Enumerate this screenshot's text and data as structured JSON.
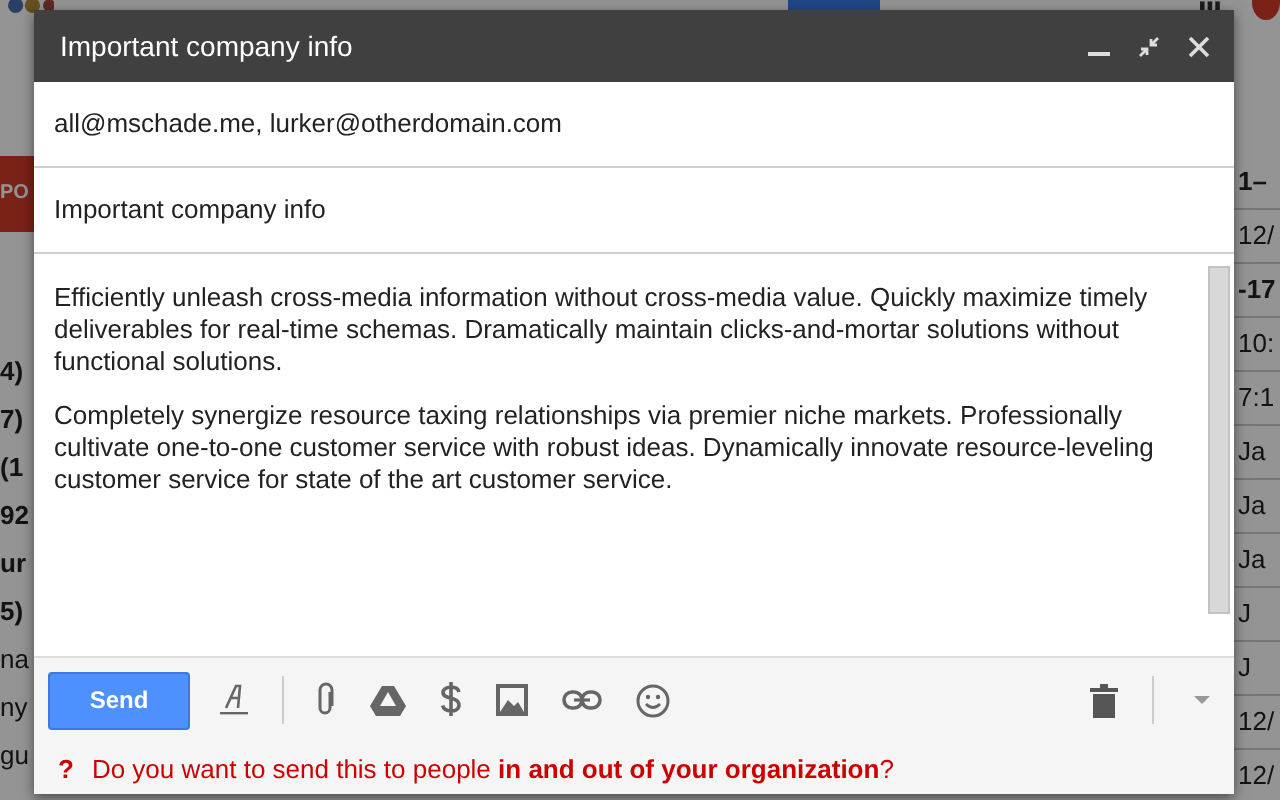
{
  "background": {
    "left_items": [
      {
        "text": "PO",
        "kind": "button"
      },
      {
        "text": "4)",
        "kind": "bold"
      },
      {
        "text": "7)",
        "kind": "bold"
      },
      {
        "text": "(1",
        "kind": "bold"
      },
      {
        "text": "92",
        "kind": "bold"
      },
      {
        "text": "ur",
        "kind": "bold"
      },
      {
        "text": "5)",
        "kind": "bold"
      },
      {
        "text": "na",
        "kind": "plain"
      },
      {
        "text": "ny",
        "kind": "plain"
      },
      {
        "text": "gu",
        "kind": "plain"
      }
    ],
    "right_items": [
      {
        "text": "1–",
        "kind": "bold"
      },
      {
        "text": "12/",
        "kind": "plain"
      },
      {
        "text": "-17",
        "kind": "bold"
      },
      {
        "text": "10:",
        "kind": "plain"
      },
      {
        "text": "7:1",
        "kind": "plain"
      },
      {
        "text": "Ja",
        "kind": "plain"
      },
      {
        "text": "Ja",
        "kind": "plain"
      },
      {
        "text": "Ja",
        "kind": "plain"
      },
      {
        "text": "J",
        "kind": "plain"
      },
      {
        "text": "J",
        "kind": "plain"
      },
      {
        "text": "12/",
        "kind": "plain"
      },
      {
        "text": "12/",
        "kind": "plain"
      }
    ]
  },
  "compose": {
    "title": "Important company info",
    "to": "all@mschade.me, lurker@otherdomain.com",
    "subject": "Important company info",
    "body": [
      "Efficiently unleash cross-media information without cross-media value. Quickly maximize timely deliverables for real-time schemas. Dramatically maintain clicks-and-mortar solutions without functional solutions.",
      "Completely synergize resource taxing relationships via premier niche markets. Professionally cultivate one-to-one customer service with robust ideas. Dynamically innovate resource-leveling customer service for state of the art customer service."
    ],
    "send_label": "Send",
    "warning": {
      "mark": "?",
      "text": "Do you want to send this to people **in and out of your organization**?"
    }
  }
}
